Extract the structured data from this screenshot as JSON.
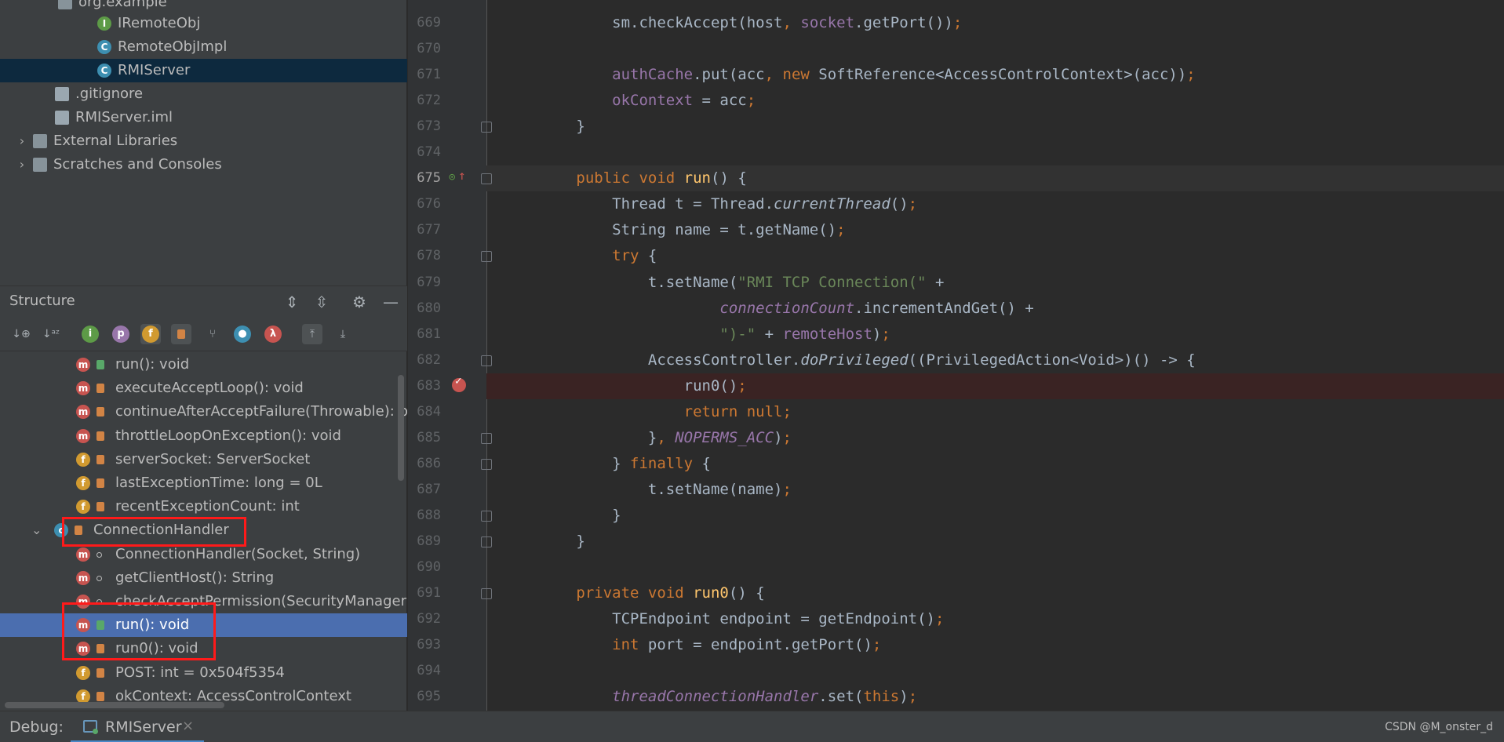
{
  "project_tree": [
    {
      "label": "org.example",
      "icon": "package-icon"
    },
    {
      "label": "IRemoteObj",
      "icon": "interface-icon",
      "glyph": "I"
    },
    {
      "label": "RemoteObjImpl",
      "icon": "class-icon",
      "glyph": "C"
    },
    {
      "label": "RMIServer",
      "icon": "class-main-icon",
      "glyph": "C",
      "selected": true
    },
    {
      "label": ".gitignore",
      "icon": "gitignore-file-icon"
    },
    {
      "label": "RMIServer.iml",
      "icon": "iml-file-icon"
    },
    {
      "label": "External Libraries",
      "icon": "libraries-icon",
      "expandable": true
    },
    {
      "label": "Scratches and Consoles",
      "icon": "scratches-icon",
      "expandable": true
    }
  ],
  "structure": {
    "title": "Structure",
    "toolbar_glyphs": {
      "i": "i",
      "p": "p",
      "f": "f",
      "lambda": "λ"
    },
    "items": [
      {
        "label": "run(): void",
        "kind": "m",
        "access": "public"
      },
      {
        "label": "executeAcceptLoop(): void",
        "kind": "m",
        "access": "private"
      },
      {
        "label": "continueAfterAcceptFailure(Throwable): bo",
        "kind": "m",
        "access": "private"
      },
      {
        "label": "throttleLoopOnException(): void",
        "kind": "m",
        "access": "private"
      },
      {
        "label": "serverSocket: ServerSocket",
        "kind": "f",
        "access": "private"
      },
      {
        "label": "lastExceptionTime: long = 0L",
        "kind": "f",
        "access": "private"
      },
      {
        "label": "recentExceptionCount: int",
        "kind": "f",
        "access": "private"
      },
      {
        "label": "ConnectionHandler",
        "kind": "c",
        "access": "private",
        "expanded": true
      },
      {
        "label": "ConnectionHandler(Socket, String)",
        "kind": "m",
        "access": "package"
      },
      {
        "label": "getClientHost(): String",
        "kind": "m",
        "access": "package"
      },
      {
        "label": "checkAcceptPermission(SecurityManager, A",
        "kind": "m",
        "access": "package"
      },
      {
        "label": "run(): void",
        "kind": "m",
        "access": "public",
        "selected": true
      },
      {
        "label": "run0(): void",
        "kind": "m",
        "access": "private"
      },
      {
        "label": "POST: int = 0x504f5354",
        "kind": "f",
        "access": "private"
      },
      {
        "label": "okContext: AccessControlContext",
        "kind": "f",
        "access": "private"
      }
    ]
  },
  "editor": {
    "lines": [
      {
        "n": "669",
        "html": "            sm.checkAccept(host<span class=\"k\">, </span><span class=\"fld\">socket</span>.getPort())<span class=\"k\">;</span>"
      },
      {
        "n": "670",
        "html": ""
      },
      {
        "n": "671",
        "html": "            <span class=\"fld\">authCache</span>.put(acc<span class=\"k\">, new </span>SoftReference&lt;AccessControlContext&gt;(acc))<span class=\"k\">;</span>"
      },
      {
        "n": "672",
        "html": "            <span class=\"fld\">okContext </span>= acc<span class=\"k\">;</span>"
      },
      {
        "n": "673",
        "html": "        }"
      },
      {
        "n": "674",
        "html": ""
      },
      {
        "n": "675",
        "html": "        <span class=\"k\">public void </span><span class=\"fn\">run</span>() {"
      },
      {
        "n": "676",
        "html": "            Thread t = Thread.<span class=\"it\">currentThread</span>()<span class=\"k\">;</span>"
      },
      {
        "n": "677",
        "html": "            String name = t.getName()<span class=\"k\">;</span>"
      },
      {
        "n": "678",
        "html": "            <span class=\"k\">try </span>{"
      },
      {
        "n": "679",
        "html": "                t.setName(<span class=\"str\">\"RMI TCP Connection(\" </span>+"
      },
      {
        "n": "680",
        "html": "                        <span class=\"ifld\">connectionCount</span>.incrementAndGet() +"
      },
      {
        "n": "681",
        "html": "                        <span class=\"str\">\")-\" </span>+ <span class=\"fld\">remoteHost</span>)<span class=\"k\">;</span>"
      },
      {
        "n": "682",
        "html": "                AccessController.<span class=\"it\">doPrivileged</span>((PrivilegedAction&lt;Void&gt;)() -&gt; {"
      },
      {
        "n": "683",
        "html": "                    run0()<span class=\"k\">;</span>"
      },
      {
        "n": "684",
        "html": "                    <span class=\"k\">return null;</span>"
      },
      {
        "n": "685",
        "html": "                }<span class=\"k\">, </span><span class=\"ifld\">NOPERMS_ACC</span>)<span class=\"k\">;</span>"
      },
      {
        "n": "686",
        "html": "            } <span class=\"k\">finally </span>{"
      },
      {
        "n": "687",
        "html": "                t.setName(name)<span class=\"k\">;</span>"
      },
      {
        "n": "688",
        "html": "            }"
      },
      {
        "n": "689",
        "html": "        }"
      },
      {
        "n": "690",
        "html": ""
      },
      {
        "n": "691",
        "html": "        <span class=\"k\">private void </span><span class=\"fn\">run0</span>() {"
      },
      {
        "n": "692",
        "html": "            TCPEndpoint endpoint = getEndpoint()<span class=\"k\">;</span>"
      },
      {
        "n": "693",
        "html": "            <span class=\"k\">int </span>port = endpoint.getPort()<span class=\"k\">;</span>"
      },
      {
        "n": "694",
        "html": ""
      },
      {
        "n": "695",
        "html": "            <span class=\"ifld\">threadConnectionHandler</span>.set(<span class=\"k\">this</span>)<span class=\"k\">;</span>"
      }
    ],
    "current_line": "675",
    "breakpoint_line": "683"
  },
  "bottom": {
    "debug_label": "Debug:",
    "tab_label": "RMIServer",
    "close_glyph": "×",
    "watermark": "CSDN @M_onster_d"
  },
  "colors": {
    "accent": "#4b6eaf",
    "highlight_box": "#ff1a1a",
    "keyword": "#cc7832",
    "string": "#6a8759",
    "field": "#9876aa",
    "method_decl": "#ffc66d"
  }
}
